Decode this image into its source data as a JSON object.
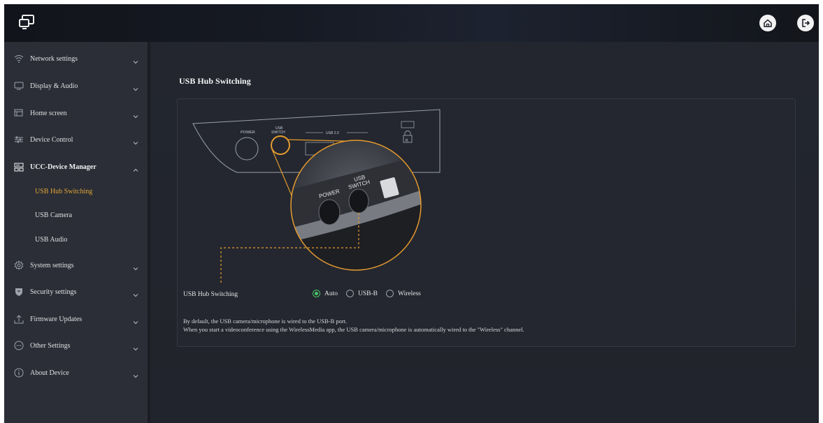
{
  "header": {
    "logo_icon": "screen-share-icon",
    "home_icon": "home-icon",
    "logout_icon": "logout-icon"
  },
  "sidebar": {
    "items": [
      {
        "label": "Network settings",
        "icon": "wifi-icon",
        "expanded": false
      },
      {
        "label": "Display & Audio",
        "icon": "monitor-icon",
        "expanded": false
      },
      {
        "label": "Home screen",
        "icon": "windows-icon",
        "expanded": false
      },
      {
        "label": "Device Control",
        "icon": "sliders-icon",
        "expanded": false
      },
      {
        "label": "UCC-Device Manager",
        "icon": "device-manager-icon",
        "expanded": true,
        "children": [
          {
            "label": "USB Hub Switching",
            "active": true
          },
          {
            "label": "USB Camera",
            "active": false
          },
          {
            "label": "USB Audio",
            "active": false
          }
        ]
      },
      {
        "label": "System settings",
        "icon": "gear-icon",
        "expanded": false
      },
      {
        "label": "Security settings",
        "icon": "shield-icon",
        "expanded": false
      },
      {
        "label": "Firmware Updates",
        "icon": "upload-icon",
        "expanded": false
      },
      {
        "label": "Other Settings",
        "icon": "more-icon",
        "expanded": false
      },
      {
        "label": "About Device",
        "icon": "info-icon",
        "expanded": false
      }
    ]
  },
  "main": {
    "title": "USB Hub Switching",
    "illustration": {
      "power_label": "POWER",
      "usb_label": "USB",
      "switch_label": "SWITCH",
      "usb20_label": "USB 2.0",
      "lock_label": "K"
    },
    "setting_label": "USB Hub Switching",
    "options": [
      {
        "label": "Auto",
        "checked": true
      },
      {
        "label": "USB-B",
        "checked": false
      },
      {
        "label": "Wireless",
        "checked": false
      }
    ],
    "description_line1": "By default, the USB camera/microphone is wired to the USB-B port.",
    "description_line2": "When you start a videoconference using the WirelessMedia app, the USB camera/microphone is automatically wired to the \"Wireless\" channel."
  },
  "colors": {
    "accent": "#e0a437",
    "radio_checked": "#4cc46b",
    "sidebar_bg": "#2b2e36",
    "main_bg": "#23262f"
  }
}
